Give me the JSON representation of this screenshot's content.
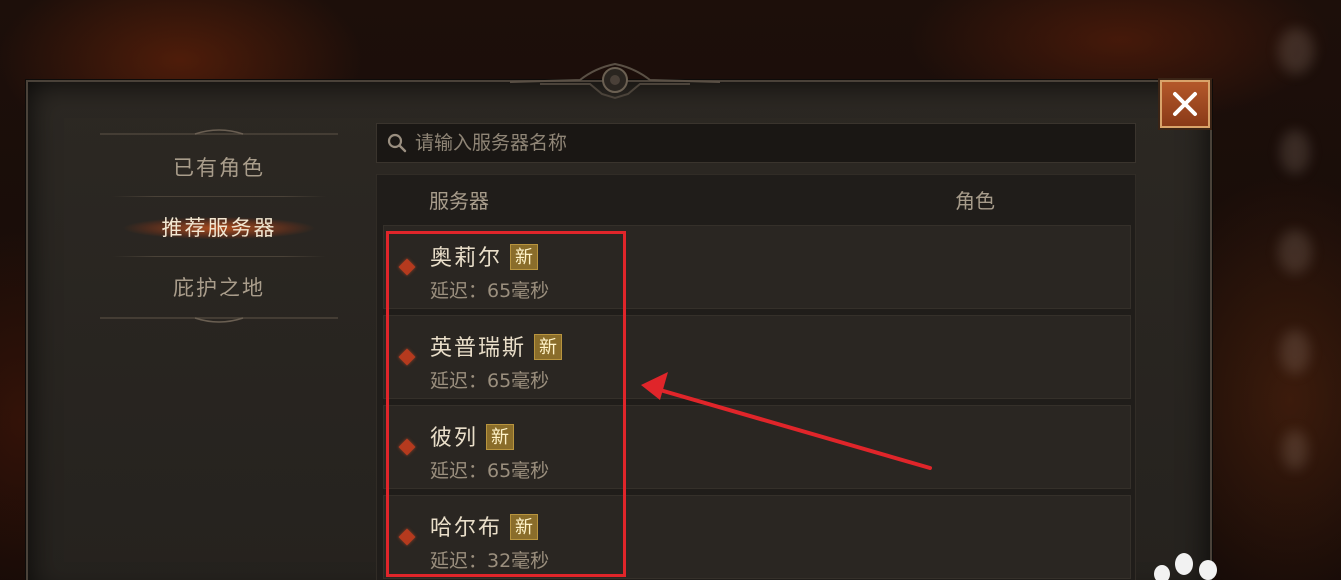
{
  "nav": {
    "items": [
      {
        "label": "已有角色",
        "active": false
      },
      {
        "label": "推荐服务器",
        "active": true
      },
      {
        "label": "庇护之地",
        "active": false
      }
    ]
  },
  "search": {
    "placeholder": "请输入服务器名称",
    "value": ""
  },
  "table": {
    "columns": {
      "server": "服务器",
      "character": "角色"
    },
    "rows": [
      {
        "name": "奥莉尔",
        "badge": "新",
        "latency": "延迟：65毫秒"
      },
      {
        "name": "英普瑞斯",
        "badge": "新",
        "latency": "延迟：65毫秒"
      },
      {
        "name": "彼列",
        "badge": "新",
        "latency": "延迟：65毫秒"
      },
      {
        "name": "哈尔布",
        "badge": "新",
        "latency": "延迟：32毫秒"
      }
    ]
  },
  "icons": {
    "close": "close-icon",
    "search": "search-icon",
    "row_marker": "diamond-icon"
  },
  "colors": {
    "accent": "#b4582a",
    "badge": "#8a6d2a",
    "annotation": "#e0252a",
    "row_marker": "#b53a1e"
  }
}
